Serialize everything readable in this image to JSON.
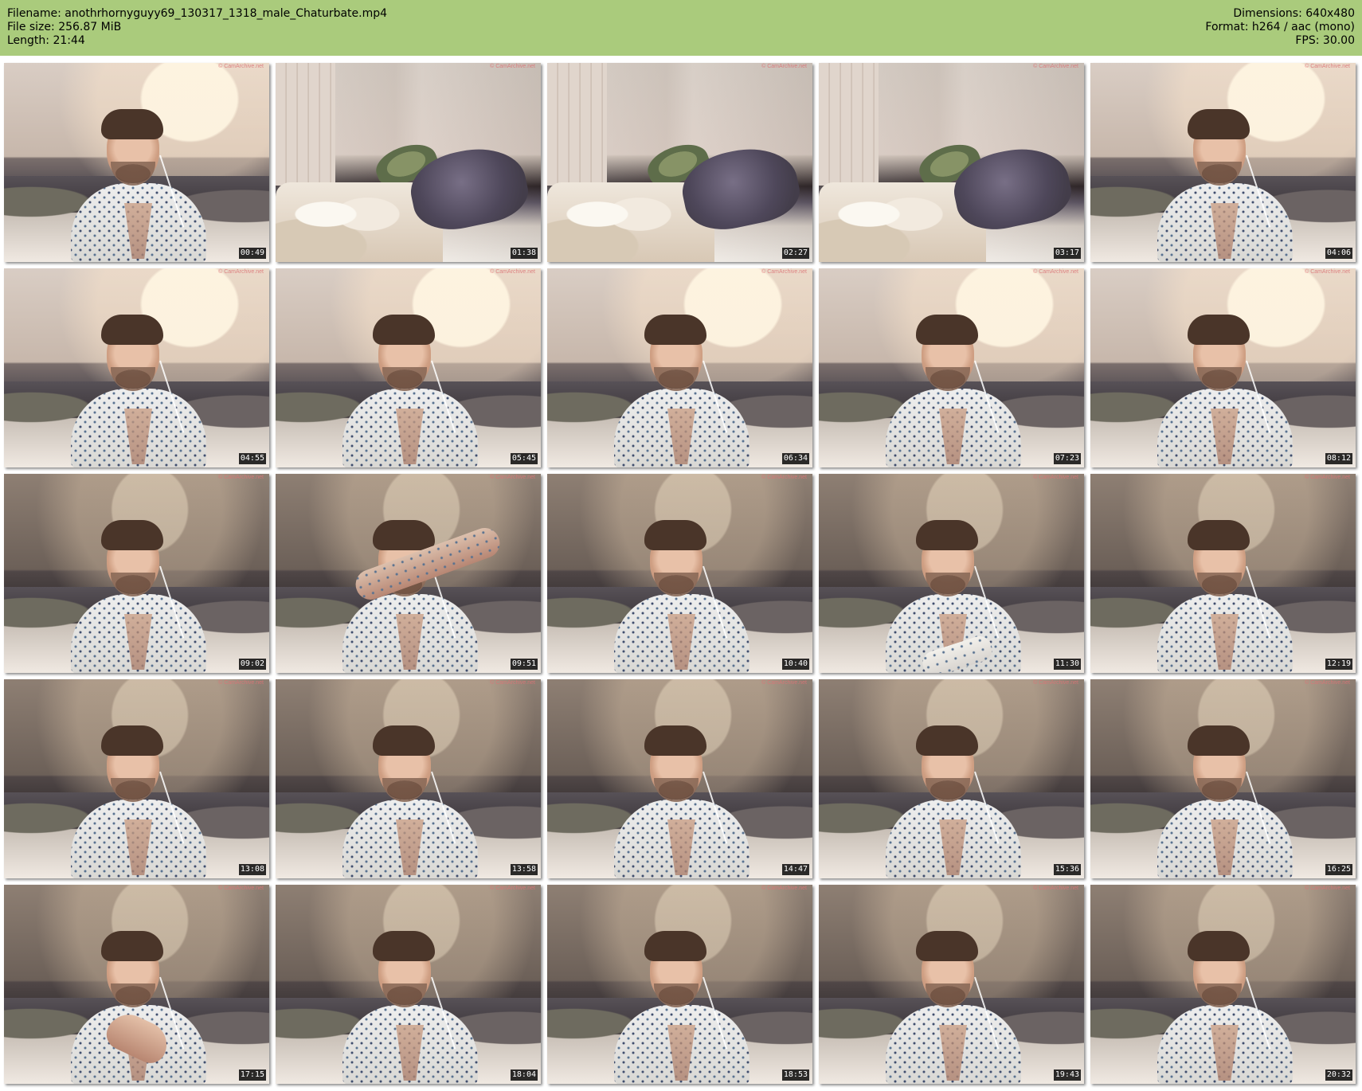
{
  "header": {
    "filename": "Filename: anothrhornyguyy69_130317_1318_male_Chaturbate.mp4",
    "file_size": "File size: 256.87 MiB",
    "length": "Length: 21:44",
    "dimensions": "Dimensions: 640x480",
    "format": "Format: h264 / aac (mono)",
    "fps": "FPS: 30.00",
    "background_color": "#aacb7c"
  },
  "thumbnails": [
    {
      "time": "00:49",
      "scene": "person"
    },
    {
      "time": "01:38",
      "scene": "room"
    },
    {
      "time": "02:27",
      "scene": "room"
    },
    {
      "time": "03:17",
      "scene": "room"
    },
    {
      "time": "04:06",
      "scene": "person"
    },
    {
      "time": "04:55",
      "scene": "person"
    },
    {
      "time": "05:45",
      "scene": "person"
    },
    {
      "time": "06:34",
      "scene": "person"
    },
    {
      "time": "07:23",
      "scene": "person"
    },
    {
      "time": "08:12",
      "scene": "person"
    },
    {
      "time": "09:02",
      "scene": "person-dim"
    },
    {
      "time": "09:51",
      "scene": "person-arm-up"
    },
    {
      "time": "10:40",
      "scene": "person-dim"
    },
    {
      "time": "11:30",
      "scene": "person-arm-side"
    },
    {
      "time": "12:19",
      "scene": "person-dim"
    },
    {
      "time": "13:08",
      "scene": "person-dim"
    },
    {
      "time": "13:58",
      "scene": "person-dim"
    },
    {
      "time": "14:47",
      "scene": "person-dim"
    },
    {
      "time": "15:36",
      "scene": "person-dim"
    },
    {
      "time": "16:25",
      "scene": "person-dim"
    },
    {
      "time": "17:15",
      "scene": "person-hand"
    },
    {
      "time": "18:04",
      "scene": "person-dim"
    },
    {
      "time": "18:53",
      "scene": "person-dim"
    },
    {
      "time": "19:43",
      "scene": "person-dim"
    },
    {
      "time": "20:32",
      "scene": "person-dim"
    }
  ],
  "watermark": "© CamArchive.net"
}
